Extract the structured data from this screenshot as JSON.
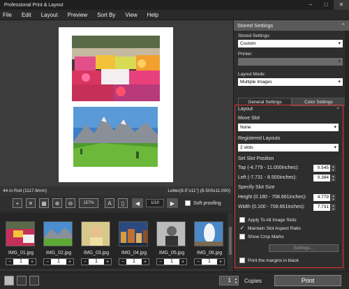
{
  "app": {
    "title": "Professional Print & Layout"
  },
  "window_controls": {
    "minimize": "–",
    "maximize": "□",
    "close": "✕"
  },
  "menu": [
    "File",
    "Edit",
    "Layout",
    "Preview",
    "Sort By",
    "View",
    "Help"
  ],
  "status": {
    "left": "44 in Roll (1117.6mm)",
    "right": "Letter(8.5\"x11\") (8.500x11.000)"
  },
  "toolbar": {
    "zoom_value": "157%",
    "page_indicator": "1/10",
    "soft_proofing_label": "Soft proofing",
    "soft_proofing_checked": false
  },
  "thumbnails": [
    {
      "name": "IMG_01.jpg",
      "copies": "1"
    },
    {
      "name": "IMG_02.jpg",
      "copies": "1"
    },
    {
      "name": "IMG_03.jpg",
      "copies": "1"
    },
    {
      "name": "IMG_04.jpg",
      "copies": "1"
    },
    {
      "name": "IMG_05.jpg",
      "copies": "1"
    },
    {
      "name": "IMG_06.jpg",
      "copies": "1"
    }
  ],
  "bottom": {
    "copies_value": "1",
    "copies_label": "Copies",
    "print_label": "Print"
  },
  "panel": {
    "stored_settings_header": "Stored Settings",
    "stored_settings_label": "Stored Settings:",
    "stored_settings_value": "Custom",
    "printer_label": "Printer:",
    "printer_value": "",
    "layout_mode_label": "Layout Mode:",
    "layout_mode_value": "Multiple Images",
    "tab_general": "General Settings",
    "tab_color": "Color Settings",
    "layout_header": "Layout",
    "move_slot_label": "Move Slot",
    "move_slot_value": "None",
    "registered_layouts_label": "Registered Layouts",
    "registered_layouts_value": "2 slots",
    "set_slot_position_label": "Set Slot Position",
    "top_label": "Top (-4.779 - 11.000inches):",
    "top_value": "0.545",
    "left_label": "Left (-7.731 - 8.500inches):",
    "left_value": "0.384",
    "specify_slot_size_label": "Specify Slot Size",
    "height_label": "Height (0.180 - 708.661inches):",
    "height_value": "4.779",
    "width_label": "Width (0.100 - 708.661inches):",
    "width_value": "7.731",
    "apply_all_label": "Apply To All Image Slots",
    "apply_all_checked": false,
    "maintain_aspect_label": "Maintain Slot Aspect Ratio",
    "maintain_aspect_checked": true,
    "show_crop_label": "Show Crop Marks",
    "show_crop_checked": false,
    "settings_button": "Settings...",
    "print_margins_label": "Print the margins in black",
    "print_margins_checked": false
  },
  "colors": {
    "highlight_border": "#e0332f",
    "panel_header": "#5a5a5a"
  }
}
